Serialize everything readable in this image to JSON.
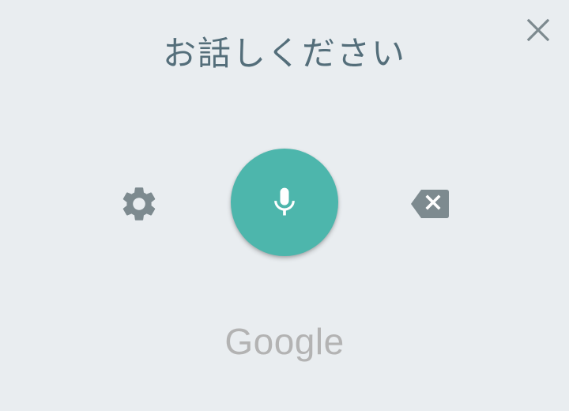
{
  "dialog": {
    "title": "お話しください",
    "brand": "Google"
  },
  "controls": {
    "close_icon": "close-icon",
    "settings_icon": "gear-icon",
    "mic_icon": "microphone-icon",
    "backspace_icon": "backspace-icon"
  },
  "colors": {
    "background": "#e9edf0",
    "title": "#546e7a",
    "mic_accent": "#4db6ac",
    "icon_gray": "#7d8a8f",
    "brand_gray": "#b3b3b3"
  }
}
